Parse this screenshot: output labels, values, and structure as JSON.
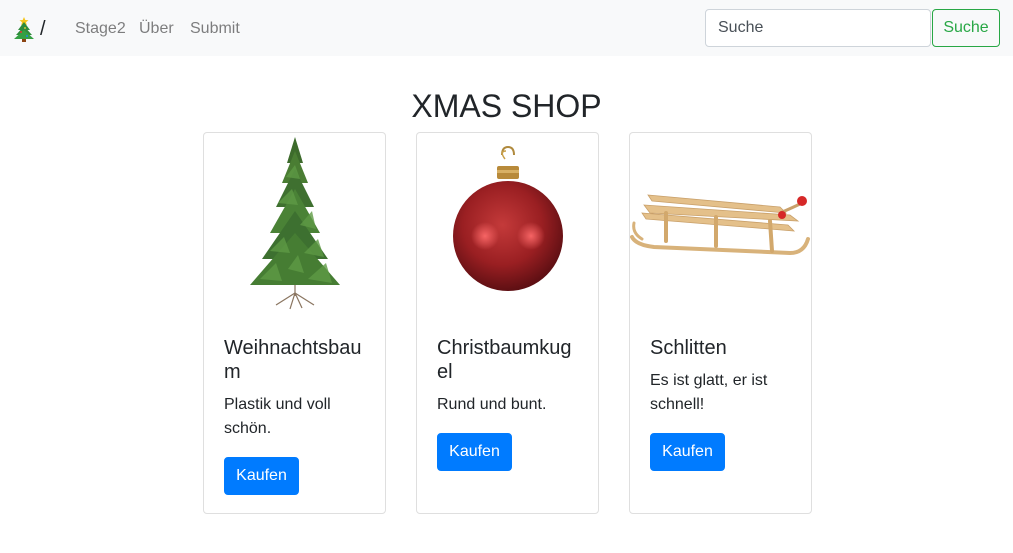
{
  "navbar": {
    "brand_icon": "christmas-tree-icon",
    "brand_text": "/",
    "links": [
      "Stage2",
      "Über",
      "Submit"
    ],
    "search": {
      "placeholder": "Suche",
      "value": "",
      "button_label": "Suche"
    }
  },
  "page": {
    "title": "XMAS SHOP"
  },
  "products": [
    {
      "title": "Weihnachtsbaum",
      "text": "Plastik und voll schön.",
      "button_label": "Kaufen",
      "image_icon": "christmas-tree-image"
    },
    {
      "title": "Christbaumkugel",
      "text": "Rund und bunt.",
      "button_label": "Kaufen",
      "image_icon": "ornament-ball-image"
    },
    {
      "title": "Schlitten",
      "text": "Es ist glatt, er ist schnell!",
      "button_label": "Kaufen",
      "image_icon": "sled-image"
    }
  ],
  "colors": {
    "primary": "#007bff",
    "success": "#28a745",
    "navbar_bg": "#f8f9fa"
  }
}
